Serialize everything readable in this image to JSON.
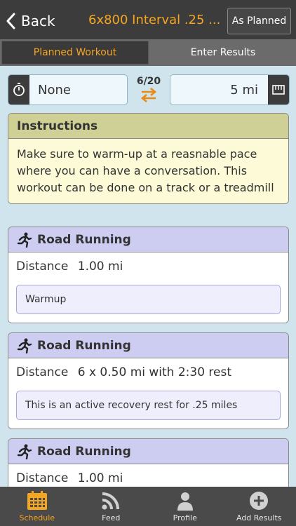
{
  "navbar": {
    "back_label": "Back",
    "title": "6x800 Interval .25 ...",
    "planned_button": "As Planned"
  },
  "tabs": [
    {
      "label": "Planned Workout",
      "active": true
    },
    {
      "label": "Enter Results",
      "active": false
    }
  ],
  "controls": {
    "timer_value": "None",
    "counter": "6/20",
    "distance_value": "5 mi",
    "icons": {
      "timer": "stopwatch-icon",
      "swap": "swap-arrows-icon",
      "distance": "ruler-icon"
    }
  },
  "instructions": {
    "title": "Instructions",
    "text": "Make sure to warm-up at a reasnable pace where you can have a conversation. This workout can be done on a track or a treadmill"
  },
  "steps": [
    {
      "title": "Road Running",
      "distance_label": "Distance",
      "distance_value": "1.00 mi",
      "note": "Warmup"
    },
    {
      "title": "Road Running",
      "distance_label": "Distance",
      "distance_value": "6 x 0.50 mi with 2:30 rest",
      "note": "This is an active recovery rest for .25 miles"
    },
    {
      "title": "Road Running",
      "distance_label": "Distance",
      "distance_value": "1.00 mi"
    }
  ],
  "tabbar": [
    {
      "label": "Schedule",
      "icon": "calendar-icon",
      "active": true
    },
    {
      "label": "Feed",
      "icon": "rss-icon",
      "active": false
    },
    {
      "label": "Profile",
      "icon": "person-icon",
      "active": false
    },
    {
      "label": "Add Results",
      "icon": "plus-circle-icon",
      "active": false
    }
  ],
  "colors": {
    "accent": "#f4a521",
    "nav_bg": "#3c3c3c",
    "page_bg": "#cfe4ec"
  }
}
